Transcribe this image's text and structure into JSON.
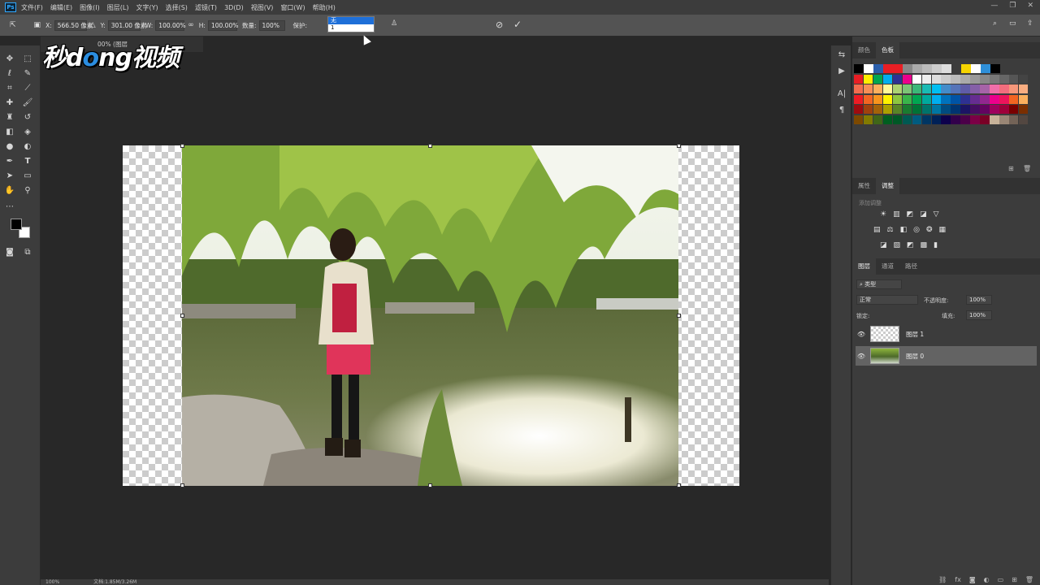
{
  "menubar": {
    "app_icon": "Ps",
    "items": [
      "文件(F)",
      "编辑(E)",
      "图像(I)",
      "图层(L)",
      "文字(Y)",
      "选择(S)",
      "滤镜(T)",
      "3D(D)",
      "视图(V)",
      "窗口(W)",
      "帮助(H)"
    ],
    "window_controls": [
      "minimize-icon",
      "maximize-icon",
      "close-icon"
    ]
  },
  "options_bar": {
    "x_label": "X:",
    "x_value": "566.50 像素",
    "y_label": "Y:",
    "y_value": "301.00 像素",
    "w_label": "W:",
    "w_value": "100.00%",
    "h_label": "H:",
    "h_value": "100.00%",
    "amount_label": "数量:",
    "amount_value": "100%",
    "protect_label": "保护:",
    "protect_value": "无",
    "protect_options": [
      "无",
      "1"
    ]
  },
  "document": {
    "tab_title": "00% (图层",
    "watermark_parts": [
      "秒d",
      "o",
      "ng视频"
    ]
  },
  "status_bar": {
    "zoom": "100%",
    "doc_info": "文档:1.85M/3.26M"
  },
  "swatches_panel": {
    "tabs": [
      "颜色",
      "色板"
    ],
    "active_tab": "色板"
  },
  "adjustments_panel": {
    "tabs": [
      "属性",
      "调整"
    ],
    "active_tab": "调整",
    "hint": "添加调整"
  },
  "layers_panel": {
    "tabs": [
      "图层",
      "通道",
      "路径"
    ],
    "active_tab": "图层",
    "filter_placeholder": "类型",
    "blend_mode": "正常",
    "opacity_label": "不透明度:",
    "opacity_value": "100%",
    "lock_label": "锁定:",
    "fill_label": "填充:",
    "fill_value": "100%",
    "layers": [
      {
        "name": "图层 1",
        "visible": true,
        "selected": false
      },
      {
        "name": "图层 0",
        "visible": true,
        "selected": true
      }
    ]
  },
  "colors": {
    "accent": "#31a8ff",
    "selection": "#1e6fd8",
    "ui_bg": "#3c3c3c",
    "canvas_bg": "#282828"
  }
}
